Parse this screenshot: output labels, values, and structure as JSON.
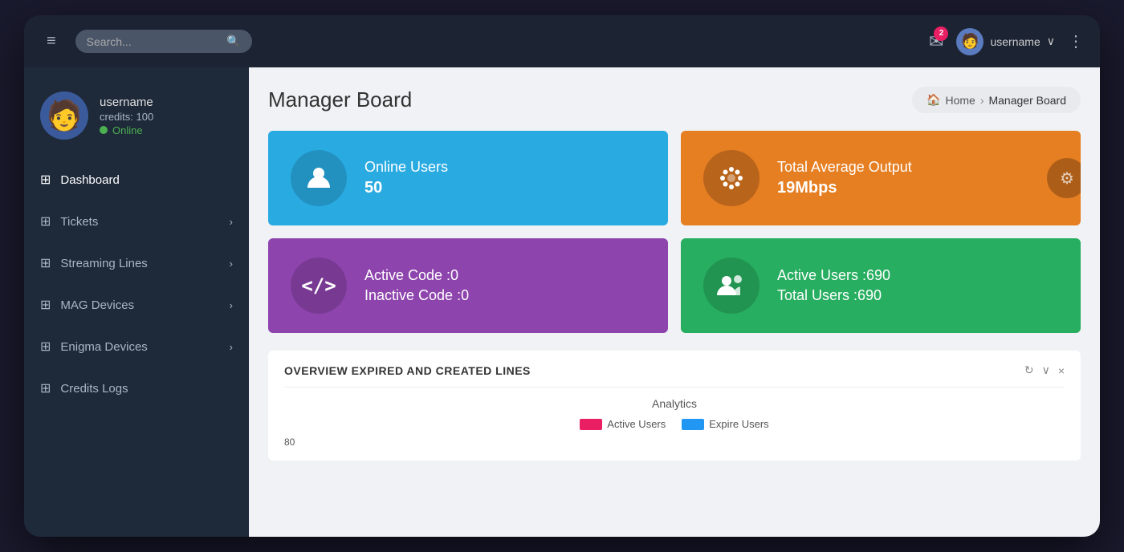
{
  "topbar": {
    "search_placeholder": "Search...",
    "notification_count": "2",
    "username": "username",
    "more_icon": "⋮"
  },
  "sidebar": {
    "user": {
      "name": "username",
      "credits": "credits: 100",
      "status": "Online"
    },
    "nav_items": [
      {
        "id": "dashboard",
        "label": "Dashboard",
        "icon": "⊞",
        "chevron": false,
        "active": true
      },
      {
        "id": "tickets",
        "label": "Tickets",
        "icon": "⊞",
        "chevron": true,
        "active": false
      },
      {
        "id": "streaming-lines",
        "label": "Streaming Lines",
        "icon": "⊞",
        "chevron": true,
        "active": false
      },
      {
        "id": "mag-devices",
        "label": "MAG Devices",
        "icon": "⊞",
        "chevron": true,
        "active": false
      },
      {
        "id": "enigma-devices",
        "label": "Enigma Devices",
        "icon": "⊞",
        "chevron": true,
        "active": false
      },
      {
        "id": "credits-logs",
        "label": "Credits Logs",
        "icon": "⊞",
        "chevron": false,
        "active": false
      }
    ]
  },
  "page": {
    "title": "Manager Board",
    "breadcrumb_home": "Home",
    "breadcrumb_current": "Manager Board"
  },
  "stats": [
    {
      "id": "online-users",
      "label": "Online Users",
      "value": "50",
      "value2": null,
      "card_class": "stat-card-blue",
      "icon": "👤"
    },
    {
      "id": "total-average-output",
      "label": "Total Average Output",
      "value": "19Mbps",
      "value2": null,
      "card_class": "stat-card-orange",
      "icon": "⚙",
      "gear": true
    },
    {
      "id": "active-inactive-code",
      "label": "Active Code :0",
      "value": "Inactive Code :0",
      "value2": null,
      "card_class": "stat-card-purple",
      "icon": "</>"
    },
    {
      "id": "active-total-users",
      "label": "Active Users :690",
      "value": "Total Users :690",
      "value2": null,
      "card_class": "stat-card-green",
      "icon": "👥"
    }
  ],
  "overview": {
    "title": "OVERVIEW EXPIRED AND CREATED LINES",
    "refresh_icon": "↻",
    "collapse_icon": "∨",
    "close_icon": "×",
    "analytics_title": "Analytics",
    "legend": [
      {
        "label": "Active Users",
        "color": "pink"
      },
      {
        "label": "Expire Users",
        "color": "blue"
      }
    ],
    "chart_value": "80"
  }
}
